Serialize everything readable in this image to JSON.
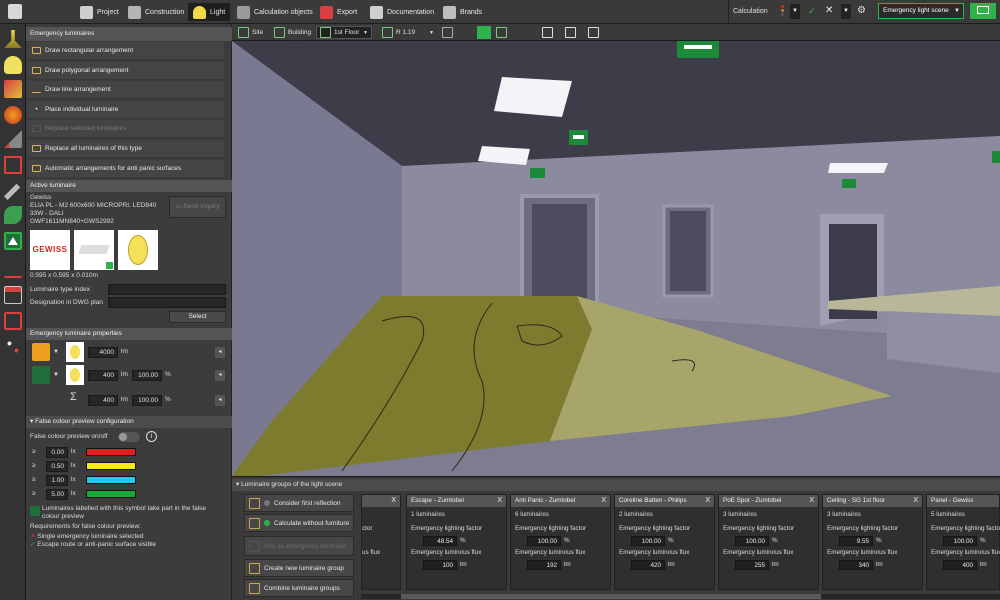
{
  "menu": {
    "items": [
      "Project",
      "Construction",
      "Light",
      "Calculation objects",
      "Export",
      "Documentation",
      "Brands"
    ],
    "active": "Light",
    "calculation_label": "Calculation",
    "scene_select": "Emergency light scene"
  },
  "viewbar": {
    "site": "Site",
    "building": "Building",
    "floor": "1st Floor",
    "room": "R 1.19"
  },
  "emergency_luminaires": {
    "heading": "Emergency luminaires",
    "actions": [
      {
        "label": "Draw rectangular arrangement",
        "enabled": true
      },
      {
        "label": "Draw polygonal arrangement",
        "enabled": true
      },
      {
        "label": "Draw line arrangement",
        "enabled": true
      },
      {
        "label": "Place individual luminaire",
        "enabled": true
      },
      {
        "label": "Replace selected luminaires",
        "enabled": false
      },
      {
        "label": "Replace all luminaires of this type",
        "enabled": true
      },
      {
        "label": "Automatic arrangements for anti panic surfaces",
        "enabled": true
      }
    ]
  },
  "active_luminaire": {
    "heading": "Active luminaire",
    "brand": "Gewiss",
    "model_line1": "ELIA PL - M2 600x600 MICROPRI. LED840",
    "model_line2": "33W - DALI",
    "model_line3": "GWF1611MN840+GWS2992",
    "send_inquiry": "Send inquiry",
    "logo_text": "GEWISS",
    "dimensions": "0.595 x 0.595 x 0.010m",
    "type_index_label": "Luminaire type index",
    "designation_label": "Designation in DWG plan",
    "select_button": "Select"
  },
  "properties": {
    "heading": "Emergency luminaire properties",
    "flux_main": "4000",
    "flux_emergency": "400",
    "factor_emergency": "100.00",
    "sum_flux": "400",
    "sum_factor": "100.00",
    "unit_lm": "lm",
    "unit_pct": "%",
    "sum_symbol": "Σ"
  },
  "false_colour": {
    "heading": "False colour preview configuration",
    "toggle_label": "False colour preview on/off",
    "info_symbol": "i",
    "thresholds": [
      {
        "symbol": "≥",
        "value": "0.00",
        "unit": "lx",
        "color": "#e02020"
      },
      {
        "symbol": "≥",
        "value": "0.50",
        "unit": "lx",
        "color": "#f5ea1a"
      },
      {
        "symbol": "≥",
        "value": "1.00",
        "unit": "lx",
        "color": "#1ec8f0"
      },
      {
        "symbol": "≥",
        "value": "5.00",
        "unit": "lx",
        "color": "#18a838"
      }
    ],
    "note": "Luminaires labelled with this symbol take part in the false colour preview",
    "requirements_heading": "Requirements for false colour preview:",
    "requirement_1": "Single emergency luminaire selected",
    "requirement_2": "Escape route or anti-panic surface visible"
  },
  "groups_panel": {
    "heading": "Luminaire groups of the light scene",
    "buttons": [
      {
        "label": "Consider first reflection",
        "enabled": true
      },
      {
        "label": "Calculate without furniture",
        "enabled": true
      },
      {
        "label": "Use as emergency luminaire",
        "enabled": false
      },
      {
        "label": "Create new luminaire group",
        "enabled": true
      },
      {
        "label": "Combine luminaire groups",
        "enabled": true
      }
    ],
    "factor_label": "Emergency lighting factor",
    "flux_label": "Emergency luminous flux",
    "partial_factor_label": "ctor",
    "partial_flux_label": "us flux",
    "close_symbol": "X",
    "unit_lm": "lm",
    "unit_pct": "%",
    "groups": [
      {
        "title": "Escape - Zumtobel",
        "count": "1 luminaires",
        "factor": "48.54",
        "flux": "100"
      },
      {
        "title": "Anti Panic - Zumtobel",
        "count": "6 luminaires",
        "factor": "100.00",
        "flux": "192"
      },
      {
        "title": "Coreline Batten - Philips",
        "count": "2 luminaires",
        "factor": "100.00",
        "flux": "420"
      },
      {
        "title": "PoE Spot - Zumtobel",
        "count": "3 luminaires",
        "factor": "100.00",
        "flux": "255"
      },
      {
        "title": "Ceiling - SG 1st floor",
        "count": "3 luminaires",
        "factor": "9.55",
        "flux": "340"
      },
      {
        "title": "Panel - Gewiss",
        "count": "5 luminaires",
        "factor": "100.00",
        "flux": "400"
      }
    ]
  },
  "colors": {
    "accent_green": "#2fb24a",
    "escape_surface": "#7d7b2e",
    "antipanic_surface": "#a8a56a"
  }
}
